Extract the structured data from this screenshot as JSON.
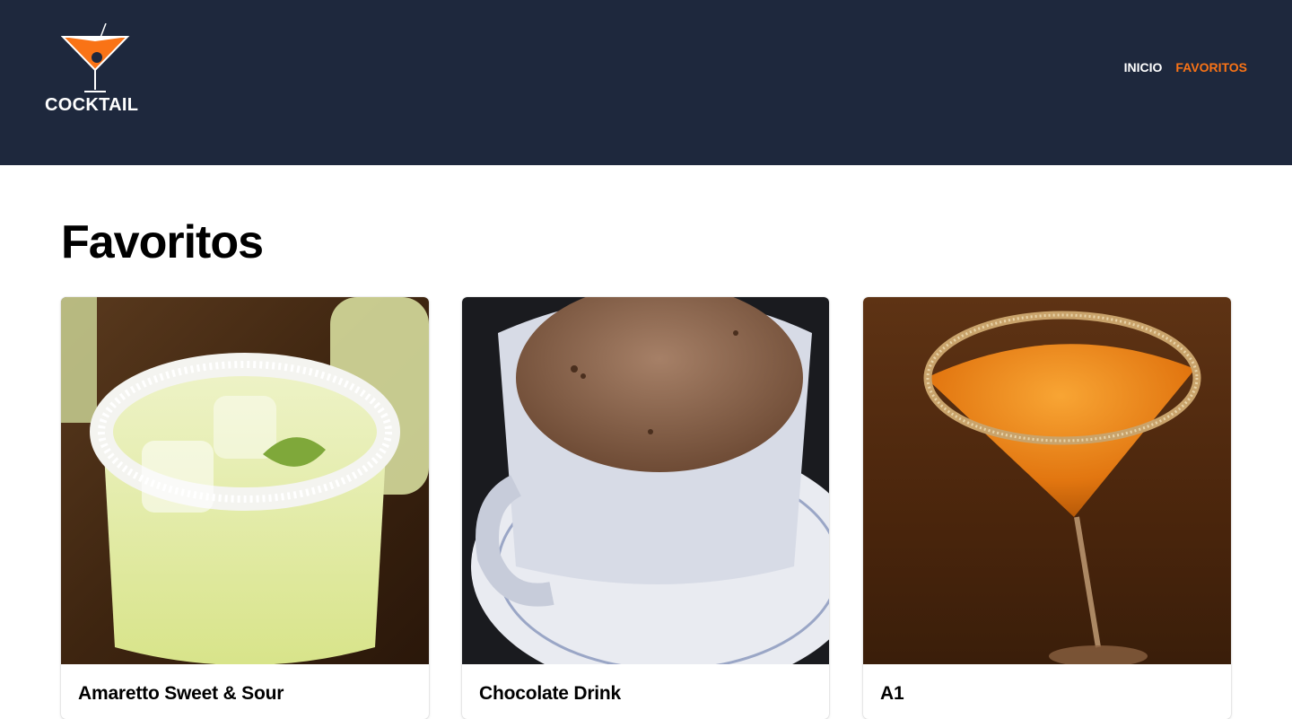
{
  "brand": {
    "name": "COCKTAIL",
    "accent": "#f97316",
    "header_bg": "#1e283d"
  },
  "nav": {
    "items": [
      {
        "label": "Inicio"
      },
      {
        "label": "Favoritos",
        "active": true
      }
    ]
  },
  "page": {
    "title": "Favoritos"
  },
  "cards": [
    {
      "title": "Amaretto Sweet & Sour",
      "image": "margarita-glass-photo"
    },
    {
      "title": "Chocolate Drink",
      "image": "hot-chocolate-mug-photo"
    },
    {
      "title": "A1",
      "image": "orange-martini-photo"
    }
  ]
}
